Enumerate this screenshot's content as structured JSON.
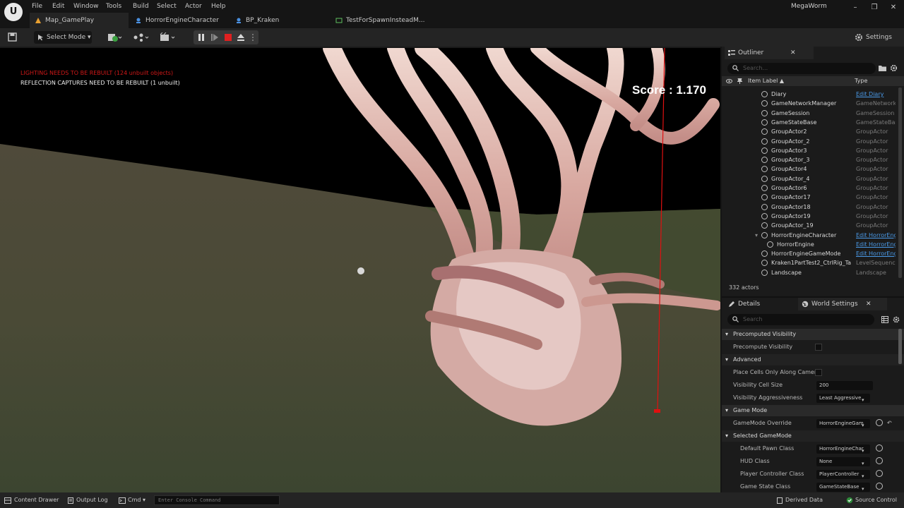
{
  "menu": [
    "File",
    "Edit",
    "Window",
    "Tools",
    "Build",
    "Select",
    "Actor",
    "Help"
  ],
  "tabs": [
    "Map_GamePlay",
    "HorrorEngineCharacter",
    "BP_Kraken",
    "TestForSpawnInsteadM..."
  ],
  "project_name": "MegaWorm",
  "window_controls": [
    "–",
    "❐",
    "✕"
  ],
  "toolbar": {
    "select_mode": "Select Mode",
    "settings": "Settings"
  },
  "viewport": {
    "warning_lighting": "LIGHTING NEEDS TO BE REBUILT (124 unbuilt objects)",
    "warning_reflection": "REFLECTION CAPTURES NEED TO BE REBUILT (1 unbuilt)",
    "score": "Score : 1.170"
  },
  "outliner": {
    "title": "Outliner",
    "search_placeholder": "Search...",
    "col_label": "Item Label ▲",
    "col_type": "Type",
    "rows": [
      {
        "name": "Diary",
        "type": "Edit Diary",
        "link": true
      },
      {
        "name": "GameNetworkManager",
        "type": "GameNetworkManager",
        "link": false
      },
      {
        "name": "GameSession",
        "type": "GameSession",
        "link": false
      },
      {
        "name": "GameStateBase",
        "type": "GameStateBase",
        "link": false
      },
      {
        "name": "GroupActor2",
        "type": "GroupActor",
        "link": false
      },
      {
        "name": "GroupActor_2",
        "type": "GroupActor",
        "link": false
      },
      {
        "name": "GroupActor3",
        "type": "GroupActor",
        "link": false
      },
      {
        "name": "GroupActor_3",
        "type": "GroupActor",
        "link": false
      },
      {
        "name": "GroupActor4",
        "type": "GroupActor",
        "link": false
      },
      {
        "name": "GroupActor_4",
        "type": "GroupActor",
        "link": false
      },
      {
        "name": "GroupActor6",
        "type": "GroupActor",
        "link": false
      },
      {
        "name": "GroupActor17",
        "type": "GroupActor",
        "link": false
      },
      {
        "name": "GroupActor18",
        "type": "GroupActor",
        "link": false
      },
      {
        "name": "GroupActor19",
        "type": "GroupActor",
        "link": false
      },
      {
        "name": "GroupActor_19",
        "type": "GroupActor",
        "link": false
      },
      {
        "name": "HorrorEngineCharacter",
        "type": "Edit HorrorEngineCharacter",
        "link": true
      },
      {
        "name": "HorrorEngine",
        "type": "Edit HorrorEngine",
        "link": true
      },
      {
        "name": "HorrorEngineGameMode",
        "type": "Edit HorrorEngineGameMode",
        "link": true
      },
      {
        "name": "Kraken1PartTest2_CtrlRig_Ta",
        "type": "LevelSequenceActor",
        "link": false
      },
      {
        "name": "Landscape",
        "type": "Landscape",
        "link": false
      }
    ],
    "actor_count": "332 actors"
  },
  "details": {
    "tab_details": "Details",
    "tab_world_settings": "World Settings",
    "search_placeholder": "Search",
    "sections": {
      "precomputed_visibility": "Precomputed Visibility",
      "advanced": "Advanced",
      "game_mode": "Game Mode",
      "selected_game_mode": "Selected GameMode"
    },
    "props": {
      "precompute_visibility": "Precompute Visibility",
      "place_cells": "Place Cells Only Along Camer...",
      "visibility_cell_size": "Visibility Cell Size",
      "visibility_cell_size_value": "200",
      "visibility_aggressiveness": "Visibility Aggressiveness",
      "visibility_aggressiveness_value": "Least Aggressive",
      "gamemode_override": "GameMode Override",
      "gamemode_override_value": "HorrorEngineGam",
      "default_pawn_class": "Default Pawn Class",
      "default_pawn_class_value": "HorrorEngineChar",
      "hud_class": "HUD Class",
      "hud_class_value": "None",
      "player_controller_class": "Player Controller Class",
      "player_controller_class_value": "PlayerController",
      "game_state_class": "Game State Class",
      "game_state_class_value": "GameStateBase"
    }
  },
  "statusbar": {
    "content_drawer": "Content Drawer",
    "output_log": "Output Log",
    "cmd": "Cmd",
    "console_placeholder": "Enter Console Command",
    "derived_data": "Derived Data",
    "source_control": "Source Control"
  }
}
